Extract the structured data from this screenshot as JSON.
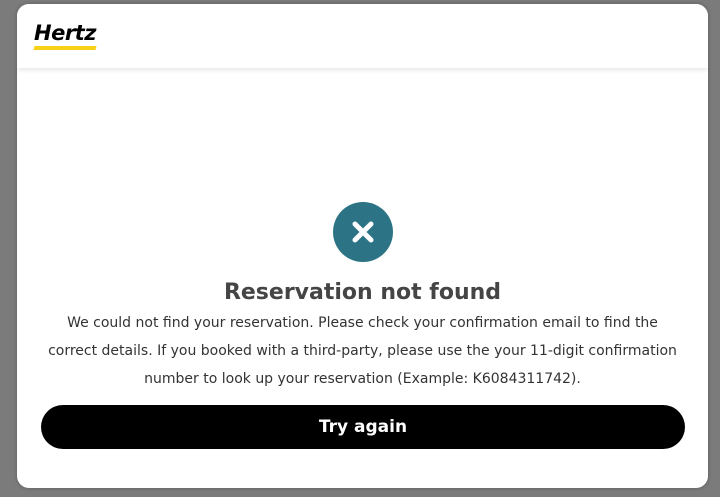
{
  "header": {
    "logo_text": "Hertz",
    "logo_accent_color": "#f7d117"
  },
  "error": {
    "icon": "close-icon",
    "icon_color": "#2b7385",
    "title": "Reservation not found",
    "message": "We could not find your reservation. Please check your confirmation email to find the correct details.  If you booked with a third-party, please use the your 11-digit confirmation number to look up your reservation (Example: K6084311742)."
  },
  "actions": {
    "try_again_label": "Try again"
  }
}
